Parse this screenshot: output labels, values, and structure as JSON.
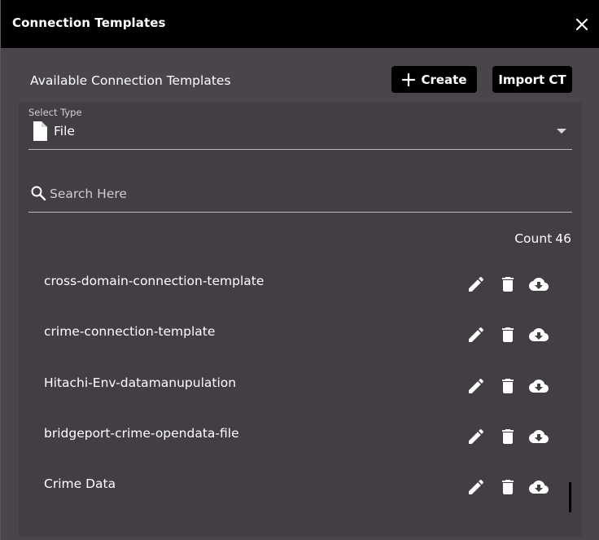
{
  "dialog": {
    "title": "Connection Templates",
    "close_icon": "close-icon"
  },
  "header": {
    "section_label": "Available Connection Templates",
    "create_label": "Create",
    "import_label": "Import CT"
  },
  "select_type": {
    "label": "Select Type",
    "value": "File",
    "icon": "file-icon"
  },
  "search": {
    "placeholder": "Search Here",
    "value": ""
  },
  "count": {
    "label": "Count",
    "value": "46"
  },
  "templates": [
    {
      "name": "cross-domain-connection-template"
    },
    {
      "name": "crime-connection-template"
    },
    {
      "name": "Hitachi-Env-datamanupulation"
    },
    {
      "name": "bridgeport-crime-opendata-file"
    },
    {
      "name": "Crime Data"
    }
  ],
  "colors": {
    "background": "#49454b",
    "panel": "#423e44",
    "titlebar": "#000000",
    "text": "#ffffff"
  }
}
